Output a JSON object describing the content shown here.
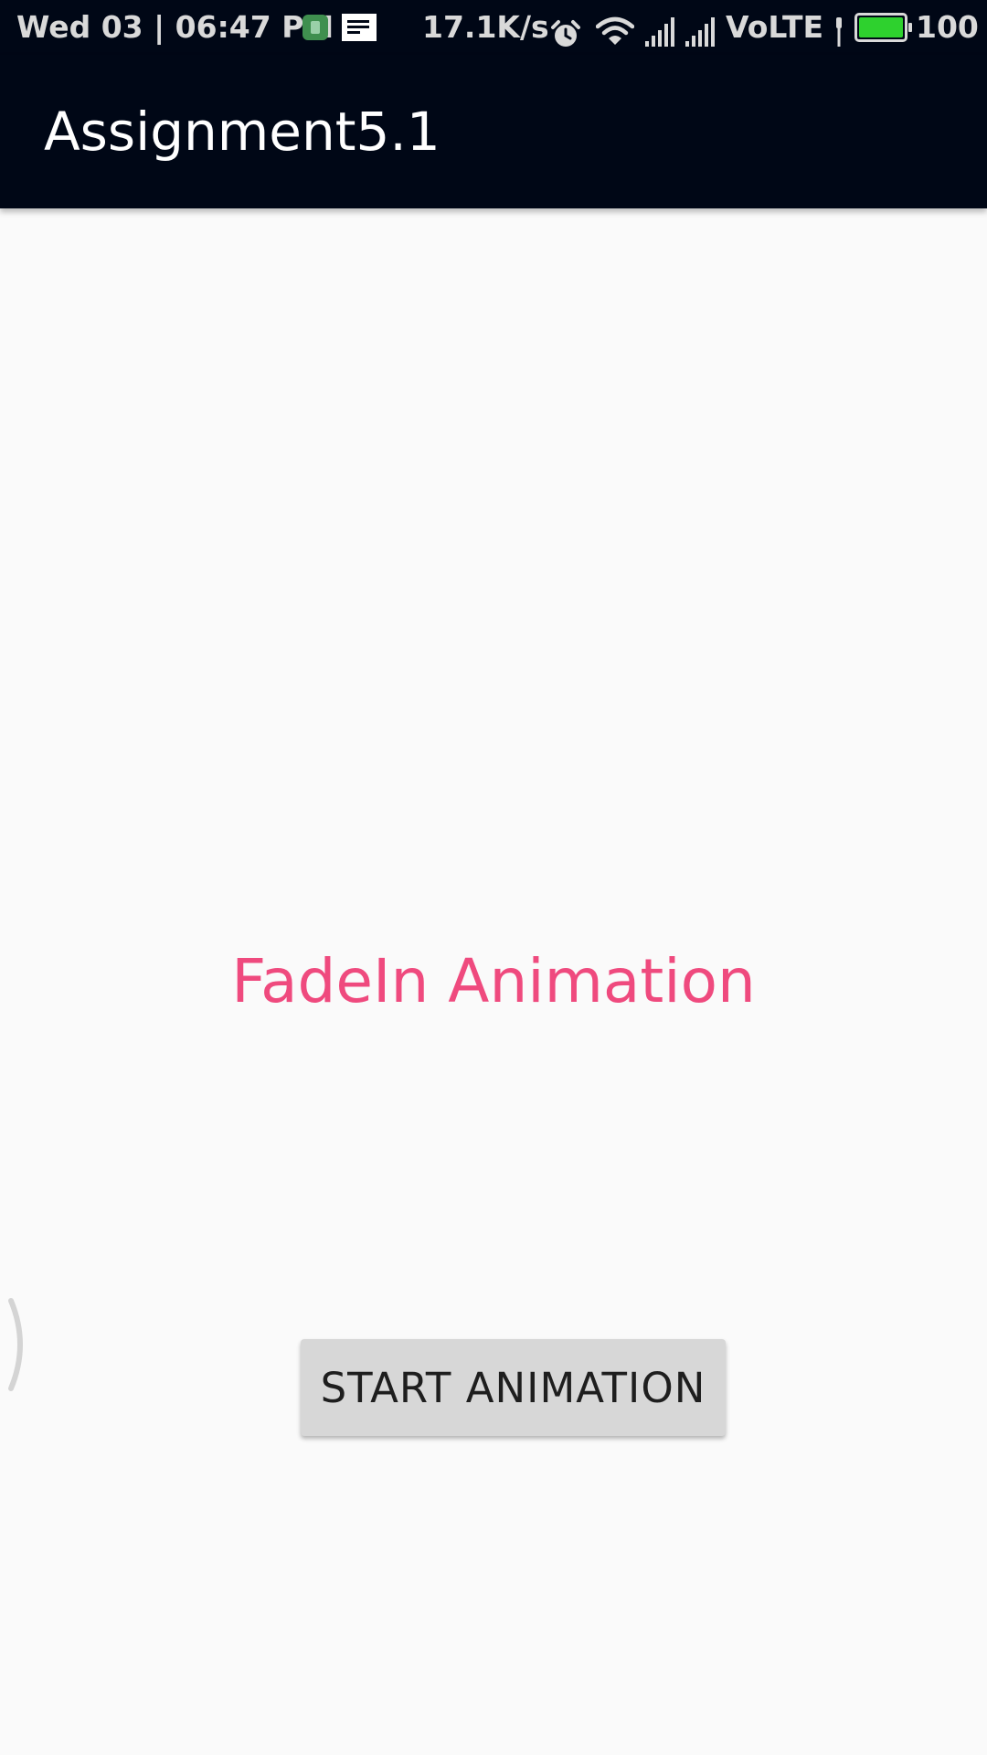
{
  "status_bar": {
    "datetime": "Wed 03 | 06:47 PM",
    "network_speed": "17.1K/s",
    "network_type": "VoLTE",
    "battery_level": "100",
    "battery_fill": 1.0,
    "battery_color": "#2ed12e",
    "icons": [
      "app-notification-icon",
      "message-icon",
      "alarm-icon",
      "wifi-icon",
      "signal-icon",
      "signal-icon",
      "charging-icon",
      "battery-icon"
    ]
  },
  "app_bar": {
    "title": "Assignment5.1",
    "background": "#000716"
  },
  "main": {
    "fade_text": "FadeIn Animation",
    "fade_text_color": "#ef4a7e",
    "start_button_label": "START ANIMATION",
    "background": "#fafafa"
  }
}
